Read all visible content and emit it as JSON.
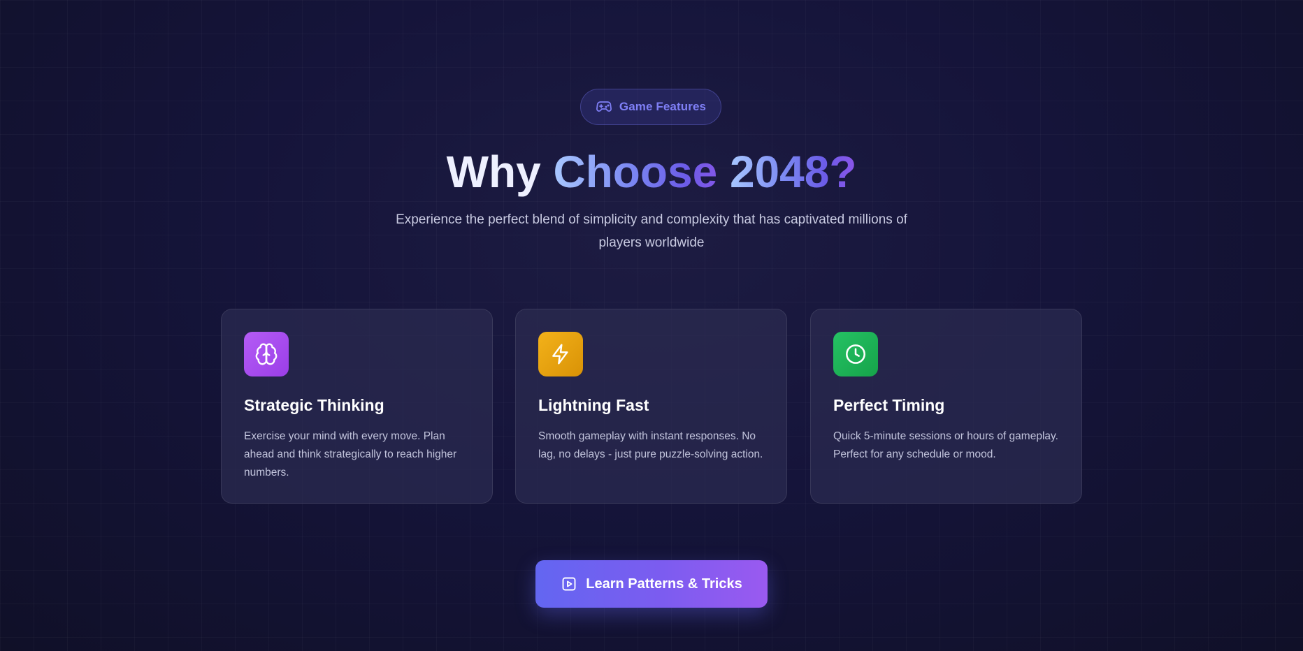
{
  "badge": {
    "label": "Game Features",
    "icon": "gamepad-icon"
  },
  "heading": {
    "part_plain": "Why ",
    "part_gradient_1": "Choose ",
    "part_gradient_2": "2048?"
  },
  "subtitle": "Experience the perfect blend of simplicity and complexity that has captivated millions of players worldwide",
  "features": [
    {
      "icon": "brain-icon",
      "color": "#a855f7",
      "title": "Strategic Thinking",
      "description": "Exercise your mind with every move. Plan ahead and think strategically to reach higher numbers."
    },
    {
      "icon": "lightning-icon",
      "color": "#eab308",
      "title": "Lightning Fast",
      "description": "Smooth gameplay with instant responses. No lag, no delays - just pure puzzle-solving action."
    },
    {
      "icon": "clock-icon",
      "color": "#22c55e",
      "title": "Perfect Timing",
      "description": "Quick 5-minute sessions or hours of gameplay. Perfect for any schedule or mood."
    }
  ],
  "cta": {
    "label": "Learn Patterns & Tricks",
    "icon": "play-square-icon"
  },
  "colors": {
    "background": "#14132e",
    "accent": "#6366f1",
    "accent_end": "#9a5af0",
    "card": "#2b2b50"
  }
}
